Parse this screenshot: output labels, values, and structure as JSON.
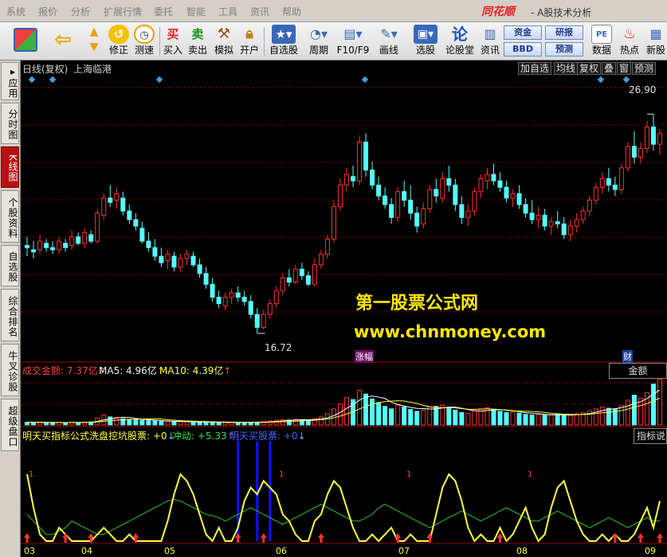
{
  "menu": {
    "items": [
      "系统",
      "报价",
      "分析",
      "扩展行情",
      "委托",
      "智能",
      "工具",
      "资讯",
      "帮助"
    ],
    "brand": "同花顺",
    "app_title": "- A股技术分析"
  },
  "toolbar": {
    "fix_label": "修正",
    "speed_label": "测速",
    "buy_label": "买入",
    "sell_label": "卖出",
    "simulate_label": "模拟",
    "open_label": "开户",
    "self_select_label": "自选股",
    "period_label": "周期",
    "f10_label": "F10/F9",
    "draw_label": "画线",
    "pick_label": "选股",
    "forum_label": "论股堂",
    "news_label": "资讯",
    "fund_label": "资金",
    "research_label": "研报",
    "bbd_label": "BBD",
    "forecast_label": "预测",
    "data_label": "数据",
    "hot_label": "热点",
    "newstock_label": "新股",
    "buy_icon_char": "买",
    "sell_icon_char": "卖",
    "forum_icon_char": "论"
  },
  "leftbar": {
    "tabs": [
      "应用",
      "分时图",
      "K线图",
      "个股资料",
      "自选股",
      "综合排名",
      "牛叉诊股",
      "超级盘口"
    ],
    "active_index": 2,
    "arrow_glyph": "▸"
  },
  "chart_header": {
    "period": "日线(复权)",
    "stock_name": "上海临港",
    "right_buttons": [
      "加自选",
      "均线",
      "复权",
      "叠",
      "窗",
      "预测"
    ]
  },
  "price_panel": {
    "high_label": "26.90",
    "low_label": "16.72",
    "event_tag_1": "涨幅",
    "event_tag_2": "财"
  },
  "volume_panel": {
    "title": "成交金额: 7.37亿",
    "ma5": "MA5: 4.96亿",
    "ma10": "MA10: 4.39亿",
    "up_arrow": "↑",
    "tag": "金额"
  },
  "indicator_panel": {
    "title": "明天买指标公式",
    "wash_label": "洗盘挖坑股票: +0",
    "impulse_label": "冲动: +5.33",
    "buy_label": "明天买股票: +0",
    "down_arrow": "↓",
    "up_arrow": "↑",
    "tag": "指标说",
    "level_label": "1"
  },
  "watermark": {
    "line1": "第一股票公式网",
    "line2": "www.chnmoney.com"
  },
  "x_axis": {
    "months": [
      "03",
      "04",
      "05",
      "06",
      "07",
      "08",
      "09"
    ]
  },
  "colors": {
    "up": "#ff3030",
    "down": "#54ffff",
    "grid": "#8b0000",
    "yellow": "#ffff40",
    "green": "#30c030",
    "blue": "#1010ff",
    "white": "#ffffff"
  },
  "chart_data": {
    "type": "candlestick",
    "ylim": [
      15.5,
      28.5
    ],
    "high": 26.9,
    "low": 16.72,
    "candles": [
      [
        0,
        20.8,
        21.2,
        20.3,
        20.7
      ],
      [
        1,
        20.6,
        21.0,
        20.2,
        20.5
      ],
      [
        2,
        20.6,
        21.3,
        20.4,
        21.0
      ],
      [
        3,
        20.9,
        21.1,
        20.5,
        20.7
      ],
      [
        4,
        20.7,
        21.0,
        20.4,
        20.6
      ],
      [
        5,
        20.6,
        21.2,
        20.4,
        21.0
      ],
      [
        6,
        20.9,
        21.1,
        20.5,
        20.7
      ],
      [
        7,
        20.8,
        21.5,
        20.6,
        21.2
      ],
      [
        8,
        21.2,
        21.4,
        20.8,
        20.9
      ],
      [
        9,
        20.9,
        21.6,
        20.7,
        21.4
      ],
      [
        10,
        21.3,
        21.5,
        20.9,
        21.0
      ],
      [
        11,
        21.0,
        22.5,
        20.9,
        22.3
      ],
      [
        12,
        22.2,
        23.2,
        22.0,
        23.0
      ],
      [
        13,
        23.0,
        23.6,
        22.6,
        22.8
      ],
      [
        14,
        22.9,
        23.5,
        22.5,
        23.2
      ],
      [
        15,
        23.0,
        23.3,
        22.2,
        22.4
      ],
      [
        16,
        22.4,
        22.7,
        21.8,
        22.0
      ],
      [
        17,
        22.0,
        22.3,
        21.5,
        21.7
      ],
      [
        18,
        21.6,
        21.9,
        20.9,
        21.0
      ],
      [
        19,
        21.0,
        21.4,
        20.5,
        20.7
      ],
      [
        20,
        20.7,
        21.1,
        20.1,
        20.3
      ],
      [
        21,
        20.3,
        20.7,
        19.8,
        20.0
      ],
      [
        22,
        20.1,
        20.6,
        19.7,
        20.4
      ],
      [
        23,
        20.3,
        20.5,
        19.6,
        19.8
      ],
      [
        24,
        19.8,
        20.4,
        19.6,
        20.2
      ],
      [
        25,
        20.2,
        20.6,
        19.9,
        20.4
      ],
      [
        26,
        20.3,
        20.5,
        19.8,
        19.9
      ],
      [
        27,
        19.9,
        20.2,
        19.3,
        19.5
      ],
      [
        28,
        19.5,
        19.8,
        18.8,
        19.0
      ],
      [
        29,
        19.0,
        19.3,
        18.2,
        18.4
      ],
      [
        30,
        18.4,
        18.7,
        17.9,
        18.1
      ],
      [
        31,
        18.0,
        18.6,
        17.8,
        18.4
      ],
      [
        32,
        18.4,
        18.8,
        18.1,
        18.6
      ],
      [
        33,
        18.6,
        18.9,
        18.2,
        18.4
      ],
      [
        34,
        18.4,
        18.7,
        18.0,
        18.2
      ],
      [
        35,
        18.2,
        18.5,
        17.4,
        17.6
      ],
      [
        36,
        17.6,
        17.9,
        16.72,
        17.0
      ],
      [
        37,
        17.0,
        17.8,
        16.9,
        17.6
      ],
      [
        38,
        17.6,
        18.3,
        17.4,
        18.1
      ],
      [
        39,
        18.1,
        18.9,
        17.9,
        18.7
      ],
      [
        40,
        18.7,
        19.5,
        18.5,
        19.3
      ],
      [
        41,
        19.3,
        19.7,
        18.9,
        19.1
      ],
      [
        42,
        19.1,
        19.9,
        19.0,
        19.7
      ],
      [
        43,
        19.7,
        20.0,
        19.2,
        19.4
      ],
      [
        44,
        19.4,
        19.6,
        18.9,
        19.0
      ],
      [
        45,
        19.0,
        20.2,
        18.9,
        19.9
      ],
      [
        46,
        19.9,
        20.6,
        19.7,
        20.4
      ],
      [
        47,
        20.4,
        21.3,
        20.2,
        21.1
      ],
      [
        48,
        21.1,
        22.9,
        20.9,
        22.6
      ],
      [
        49,
        22.6,
        23.9,
        22.4,
        23.6
      ],
      [
        50,
        23.6,
        24.4,
        23.3,
        24.1
      ],
      [
        51,
        24.0,
        24.5,
        23.5,
        23.8
      ],
      [
        52,
        23.8,
        25.9,
        23.6,
        25.6
      ],
      [
        53,
        25.6,
        26.0,
        24.0,
        24.3
      ],
      [
        54,
        24.3,
        24.7,
        23.4,
        23.6
      ],
      [
        55,
        23.6,
        24.0,
        22.9,
        23.1
      ],
      [
        56,
        23.1,
        23.5,
        22.5,
        22.7
      ],
      [
        57,
        22.7,
        23.0,
        21.8,
        22.1
      ],
      [
        58,
        22.1,
        23.5,
        21.9,
        23.3
      ],
      [
        59,
        23.3,
        23.8,
        22.6,
        22.9
      ],
      [
        60,
        22.9,
        23.6,
        22.0,
        22.3
      ],
      [
        61,
        22.3,
        22.6,
        21.4,
        21.7
      ],
      [
        62,
        21.8,
        22.8,
        21.6,
        22.5
      ],
      [
        63,
        22.5,
        23.6,
        22.3,
        23.4
      ],
      [
        64,
        23.4,
        23.9,
        22.8,
        23.1
      ],
      [
        65,
        23.0,
        24.2,
        22.8,
        23.9
      ],
      [
        66,
        23.9,
        24.5,
        23.3,
        23.6
      ],
      [
        67,
        23.6,
        23.9,
        22.4,
        22.7
      ],
      [
        68,
        22.7,
        23.1,
        21.8,
        22.1
      ],
      [
        69,
        22.1,
        22.7,
        21.7,
        22.4
      ],
      [
        70,
        22.4,
        23.5,
        22.2,
        23.3
      ],
      [
        71,
        23.3,
        24.1,
        23.0,
        23.9
      ],
      [
        72,
        23.8,
        24.4,
        23.4,
        24.1
      ],
      [
        73,
        24.1,
        24.6,
        23.6,
        23.8
      ],
      [
        74,
        23.8,
        24.2,
        23.3,
        23.5
      ],
      [
        75,
        23.5,
        23.8,
        22.8,
        23.0
      ],
      [
        76,
        23.0,
        23.4,
        22.6,
        23.2
      ],
      [
        77,
        23.2,
        23.6,
        22.5,
        22.7
      ],
      [
        78,
        22.7,
        23.0,
        22.1,
        22.3
      ],
      [
        79,
        22.3,
        22.9,
        21.8,
        22.0
      ],
      [
        80,
        22.0,
        22.6,
        21.6,
        22.2
      ],
      [
        81,
        22.2,
        22.5,
        21.5,
        21.7
      ],
      [
        82,
        21.7,
        22.1,
        21.3,
        21.9
      ],
      [
        83,
        21.9,
        22.4,
        21.6,
        21.8
      ],
      [
        84,
        21.8,
        22.1,
        21.1,
        21.3
      ],
      [
        85,
        21.3,
        22.0,
        21.0,
        21.7
      ],
      [
        86,
        21.7,
        22.3,
        21.4,
        22.0
      ],
      [
        87,
        22.0,
        22.6,
        21.8,
        22.4
      ],
      [
        88,
        22.4,
        23.1,
        22.2,
        22.9
      ],
      [
        89,
        22.9,
        23.7,
        22.7,
        23.5
      ],
      [
        90,
        23.5,
        24.2,
        23.2,
        23.9
      ],
      [
        91,
        23.9,
        24.4,
        23.3,
        23.6
      ],
      [
        92,
        23.6,
        24.0,
        23.1,
        23.4
      ],
      [
        93,
        23.4,
        24.6,
        23.2,
        24.4
      ],
      [
        94,
        24.4,
        25.6,
        24.2,
        25.4
      ],
      [
        95,
        25.4,
        26.1,
        24.6,
        24.9
      ],
      [
        96,
        24.9,
        25.6,
        24.6,
        25.3
      ],
      [
        97,
        25.3,
        26.6,
        25.1,
        26.3
      ],
      [
        98,
        26.3,
        26.9,
        25.2,
        25.5
      ],
      [
        99,
        25.5,
        26.2,
        25.0,
        26.0
      ]
    ],
    "volume": [
      0.45,
      0.4,
      0.42,
      0.38,
      0.35,
      0.4,
      0.36,
      0.42,
      0.4,
      0.44,
      0.48,
      1.1,
      1.6,
      1.3,
      1.2,
      1.0,
      0.9,
      0.8,
      0.75,
      0.7,
      0.65,
      0.6,
      0.55,
      0.5,
      0.5,
      0.52,
      0.48,
      0.45,
      0.42,
      0.4,
      0.38,
      0.4,
      0.42,
      0.4,
      0.38,
      0.42,
      0.45,
      0.55,
      0.65,
      0.75,
      0.85,
      0.8,
      0.9,
      0.85,
      0.8,
      1.0,
      1.3,
      1.8,
      2.6,
      3.4,
      4.4,
      4.1,
      5.6,
      5.0,
      4.2,
      3.6,
      3.0,
      2.6,
      3.2,
      2.9,
      2.5,
      2.2,
      2.4,
      2.9,
      3.0,
      3.2,
      2.9,
      2.4,
      2.0,
      1.9,
      2.3,
      2.6,
      2.8,
      2.5,
      2.2,
      2.0,
      2.1,
      1.9,
      1.7,
      1.6,
      1.7,
      1.6,
      1.6,
      1.7,
      1.5,
      1.6,
      1.8,
      2.0,
      2.3,
      2.6,
      2.9,
      2.7,
      2.6,
      3.1,
      4.0,
      4.8,
      4.3,
      5.2,
      6.6,
      7.37
    ],
    "volume_ylim": [
      0,
      8.5
    ],
    "indicator_yellow": [
      1.0,
      0.5,
      0.1,
      0.0,
      0.0,
      0.2,
      0.1,
      0.0,
      0.0,
      0.0,
      0.0,
      0.1,
      0.2,
      0.1,
      0.0,
      0.0,
      0.1,
      0.0,
      0.0,
      0.0,
      0.0,
      0.0,
      0.3,
      0.7,
      1.0,
      0.9,
      0.7,
      0.4,
      0.1,
      0.0,
      0.2,
      0.0,
      0.0,
      0.2,
      0.6,
      0.8,
      0.7,
      0.9,
      0.8,
      0.7,
      0.4,
      0.3,
      0.1,
      0.0,
      0.0,
      0.3,
      0.4,
      0.7,
      0.9,
      0.8,
      0.5,
      0.2,
      0.0,
      0.0,
      0.1,
      0.0,
      0.1,
      0.2,
      0.0,
      0.0,
      0.1,
      0.0,
      0.0,
      0.0,
      0.4,
      0.8,
      1.0,
      0.9,
      0.6,
      0.2,
      0.0,
      0.1,
      0.0,
      0.0,
      0.2,
      0.0,
      0.1,
      0.3,
      0.5,
      0.2,
      0.0,
      0.1,
      0.5,
      0.8,
      0.9,
      0.6,
      0.3,
      0.1,
      0.0,
      0.0,
      0.1,
      0.0,
      0.1,
      0.0,
      0.0,
      0.1,
      0.3,
      0.5,
      0.2,
      0.6
    ],
    "indicator_green": [
      0.4,
      0.3,
      0.2,
      0.1,
      0.1,
      0.15,
      0.2,
      0.3,
      0.25,
      0.2,
      0.15,
      0.1,
      0.1,
      0.15,
      0.2,
      0.25,
      0.3,
      0.35,
      0.4,
      0.45,
      0.5,
      0.55,
      0.6,
      0.62,
      0.6,
      0.55,
      0.5,
      0.45,
      0.4,
      0.38,
      0.35,
      0.3,
      0.35,
      0.4,
      0.45,
      0.5,
      0.45,
      0.4,
      0.35,
      0.3,
      0.25,
      0.3,
      0.35,
      0.4,
      0.45,
      0.5,
      0.55,
      0.5,
      0.45,
      0.4,
      0.35,
      0.3,
      0.3,
      0.35,
      0.4,
      0.5,
      0.55,
      0.5,
      0.45,
      0.4,
      0.35,
      0.3,
      0.25,
      0.2,
      0.25,
      0.3,
      0.35,
      0.4,
      0.45,
      0.4,
      0.35,
      0.3,
      0.35,
      0.4,
      0.45,
      0.5,
      0.45,
      0.4,
      0.35,
      0.3,
      0.3,
      0.35,
      0.4,
      0.45,
      0.4,
      0.35,
      0.3,
      0.25,
      0.2,
      0.25,
      0.3,
      0.35,
      0.3,
      0.25,
      0.2,
      0.25,
      0.3,
      0.35,
      0.3,
      0.3
    ],
    "buy_arrows": [
      0,
      6,
      10,
      17,
      33,
      37,
      46,
      58,
      63,
      74,
      92,
      96,
      99
    ],
    "blue_bars": [
      33,
      36,
      38
    ]
  }
}
